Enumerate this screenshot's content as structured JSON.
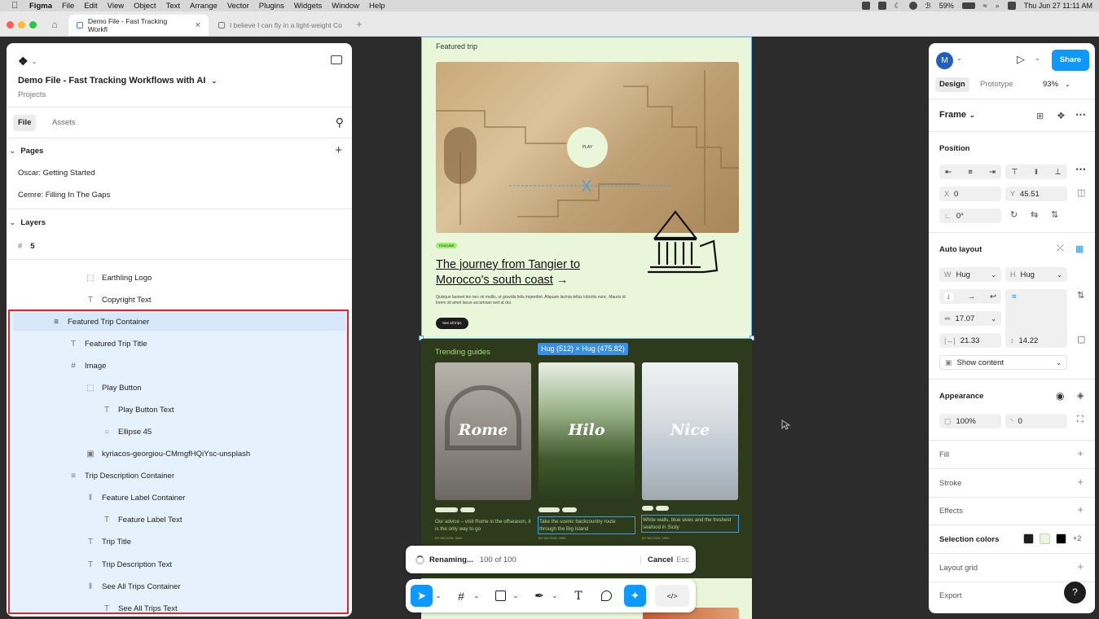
{
  "menubar": {
    "app": "Figma",
    "items": [
      "File",
      "Edit",
      "View",
      "Object",
      "Text",
      "Arrange",
      "Vector",
      "Plugins",
      "Widgets",
      "Window",
      "Help"
    ],
    "battery": "59%",
    "datetime": "Thu Jun 27  11:11 AM"
  },
  "tabs": [
    {
      "label": "Demo File - Fast Tracking Workfl",
      "active": true
    },
    {
      "label": "I believe I can fly in a light-weight Co",
      "active": false
    }
  ],
  "left_panel": {
    "file_title": "Demo File - Fast Tracking Workflows with AI",
    "breadcrumb": "Projects",
    "tab_file": "File",
    "tab_assets": "Assets",
    "pages_header": "Pages",
    "pages": [
      "Oscar: Getting Started",
      "Cemre: Filling In The Gaps"
    ],
    "layers_header": "Layers",
    "frame_name": "5",
    "layers": [
      {
        "label": "Earthling Logo",
        "icon": "dashed-frame-icon"
      },
      {
        "label": "Copyright Text",
        "icon": "text-icon"
      },
      {
        "label": "Featured Trip Container",
        "icon": "autolayout-vertical-icon"
      },
      {
        "label": "Featured Trip Title",
        "icon": "text-icon"
      },
      {
        "label": "Image",
        "icon": "frame-hash-icon"
      },
      {
        "label": "Play Button",
        "icon": "dashed-frame-icon"
      },
      {
        "label": "Play Button Text",
        "icon": "text-icon"
      },
      {
        "label": "Ellipse 45",
        "icon": "ellipse-icon"
      },
      {
        "label": "kyriacos-georgiou-CMmgfHQiYsc-unsplash",
        "icon": "image-icon"
      },
      {
        "label": "Trip Description Container",
        "icon": "autolayout-vertical-icon"
      },
      {
        "label": "Feature Label Container",
        "icon": "autolayout-horizontal-icon"
      },
      {
        "label": "Feature Label Text",
        "icon": "text-icon"
      },
      {
        "label": "Trip Title",
        "icon": "text-icon"
      },
      {
        "label": "Trip Description Text",
        "icon": "text-icon"
      },
      {
        "label": "See All Trips Container",
        "icon": "autolayout-horizontal-icon"
      },
      {
        "label": "See All Trips Text",
        "icon": "text-icon"
      }
    ]
  },
  "canvas": {
    "featured_label": "Featured trip",
    "play_text": "PLAY",
    "feature_tag": "FEATURE",
    "trip_title_line1": "The journey from Tangier to",
    "trip_title_line2": "Morocco's south coast",
    "trip_title_arrow": "→",
    "trip_desc": "Quisque laoreet leo nec mi mollis, ut gravida felis imperdiet. Aliquam lacinia tellus lobortis nunc. Mauris id lorem sit amet lacus accumsan sed at dui.",
    "see_all_btn": "See all trips",
    "trending_label": "Trending guides",
    "size_badge": "Hug (512) × Hug (475.82)",
    "guides": [
      {
        "name": "Rome",
        "desc": "Our advice – visit Rome in the offseason, it is the only way to go",
        "meta": "BY INCOGN. 0000"
      },
      {
        "name": "Hilo",
        "desc": "Take the scenic backcountry route through the Big Island",
        "meta": "BY INCOGN. 0000"
      },
      {
        "name": "Nice",
        "desc": "White walls, blue skies and the freshest seafood in Sicily",
        "meta": "BY INCOGN. 0000"
      }
    ]
  },
  "renaming_bar": {
    "status": "Renaming...",
    "progress": "100 of 100",
    "cancel": "Cancel",
    "shortcut": "Esc"
  },
  "right_panel": {
    "avatar": "M",
    "share": "Share",
    "tab_design": "Design",
    "tab_prototype": "Prototype",
    "zoom": "93%",
    "frame_label": "Frame",
    "position_label": "Position",
    "x_label": "X",
    "x_value": "0",
    "y_label": "Y",
    "y_value": "45.51",
    "rotation": "0°",
    "autolayout_label": "Auto layout",
    "w_label": "W",
    "w_value": "Hug",
    "h_label": "H",
    "h_value": "Hug",
    "gap_value": "17.07",
    "pad_h": "21.33",
    "pad_v": "14.22",
    "show_content": "Show content",
    "appearance_label": "Appearance",
    "opacity": "100%",
    "radius": "0",
    "fill_label": "Fill",
    "stroke_label": "Stroke",
    "effects_label": "Effects",
    "selection_colors_label": "Selection colors",
    "selection_colors_more": "+2",
    "selection_colors": [
      "#1e1e1e",
      "#eaf6d9",
      "#000000"
    ],
    "layout_grid_label": "Layout grid",
    "export_label": "Export",
    "help": "?"
  }
}
